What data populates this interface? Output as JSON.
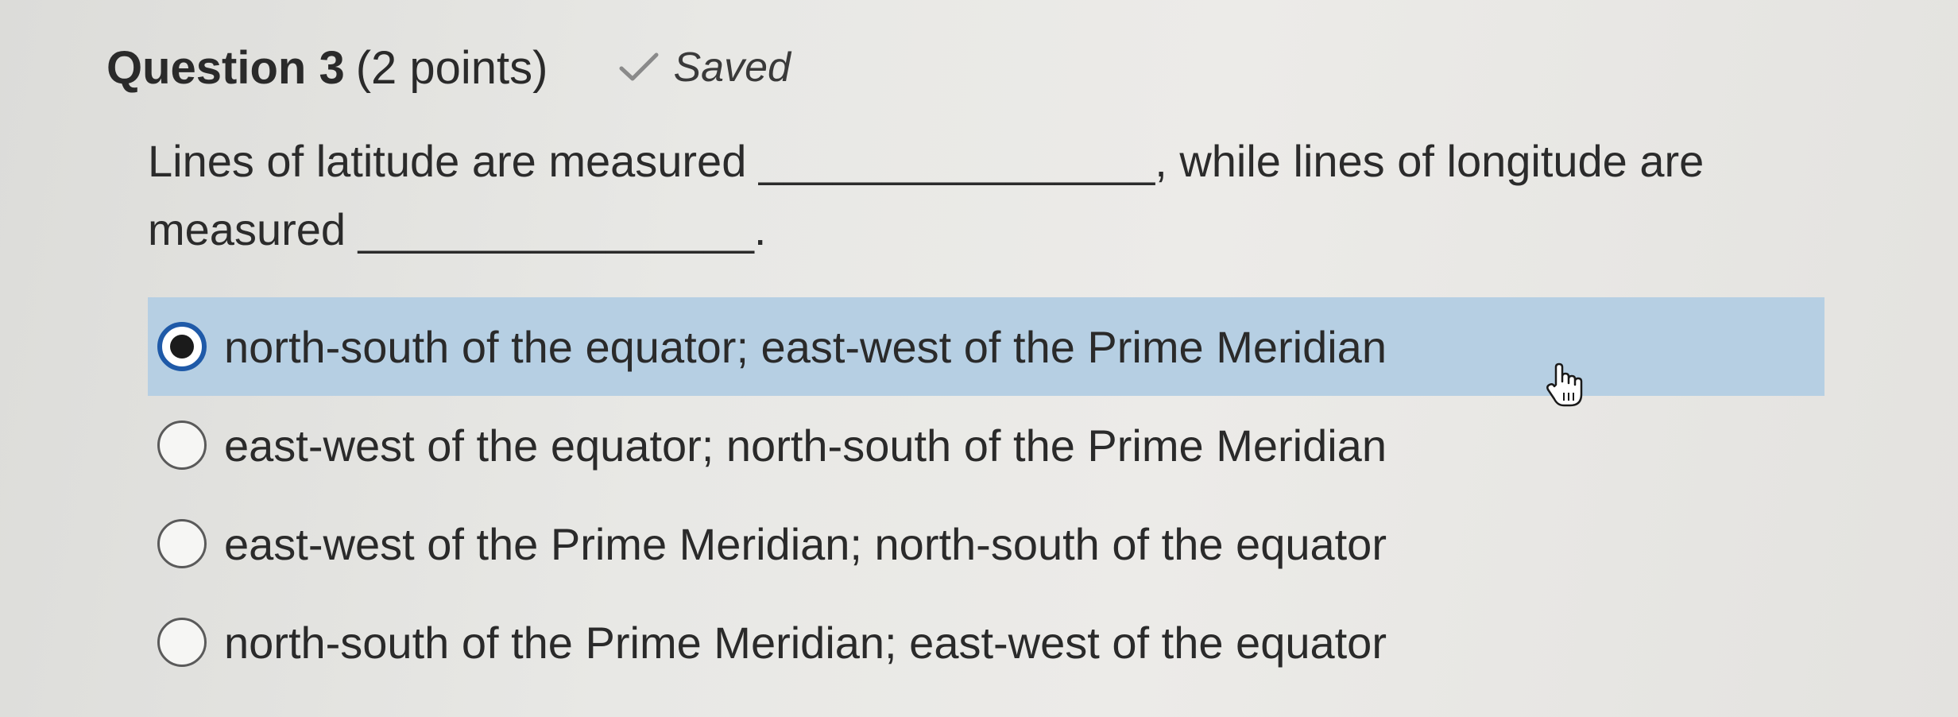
{
  "question": {
    "title": "Question 3",
    "points": "(2 points)",
    "status": "Saved",
    "status_icon": "check-icon"
  },
  "prompt": {
    "part1": "Lines of latitude are measured ",
    "blank1": "________________",
    "part2": ", while lines of longitude are measured ",
    "blank2": "________________",
    "part3": "."
  },
  "options": [
    {
      "label": "north-south of the equator; east-west of the Prime Meridian",
      "selected": true
    },
    {
      "label": "east-west of the equator; north-south of the Prime Meridian",
      "selected": false
    },
    {
      "label": "east-west of the Prime Meridian; north-south of the equator",
      "selected": false
    },
    {
      "label": "north-south of the Prime Meridian; east-west of the equator",
      "selected": false
    }
  ],
  "colors": {
    "selected_background": "#b6cfe3",
    "radio_selected_border": "#1f5aa8",
    "text": "#2a2a2a"
  },
  "cursor": "hand-pointer-icon"
}
